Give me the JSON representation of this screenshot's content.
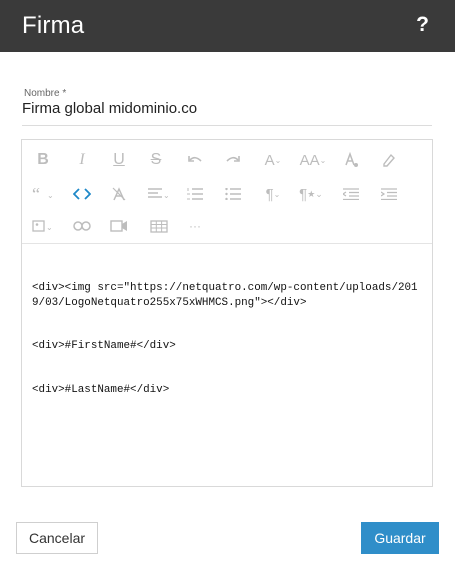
{
  "dialog": {
    "title": "Firma",
    "help_label": "?"
  },
  "form": {
    "name_label": "Nombre *",
    "name_value": "Firma global midominio.co"
  },
  "editor": {
    "code_lines": [
      "<div><img src=\"https://netquatro.com/wp-content/uploads/2019/03/LogoNetquatro255x75xWHMCS.png\"></div>",
      "<div>#FirstName#</div>",
      "<div>#LastName#</div>"
    ],
    "toolbar": {
      "bold": "B",
      "italic": "I",
      "underline": "U",
      "strike": "S",
      "font_family": "A",
      "font_size": "AA",
      "paragraph": "¶",
      "paragraph_style": "¶",
      "more": "···",
      "active_color": "#1e88c8",
      "inactive_color": "#bdbdbd"
    }
  },
  "footer": {
    "cancel_label": "Cancelar",
    "save_label": "Guardar"
  },
  "colors": {
    "header_bg": "#3a3a3a",
    "primary": "#2f8ec9"
  }
}
